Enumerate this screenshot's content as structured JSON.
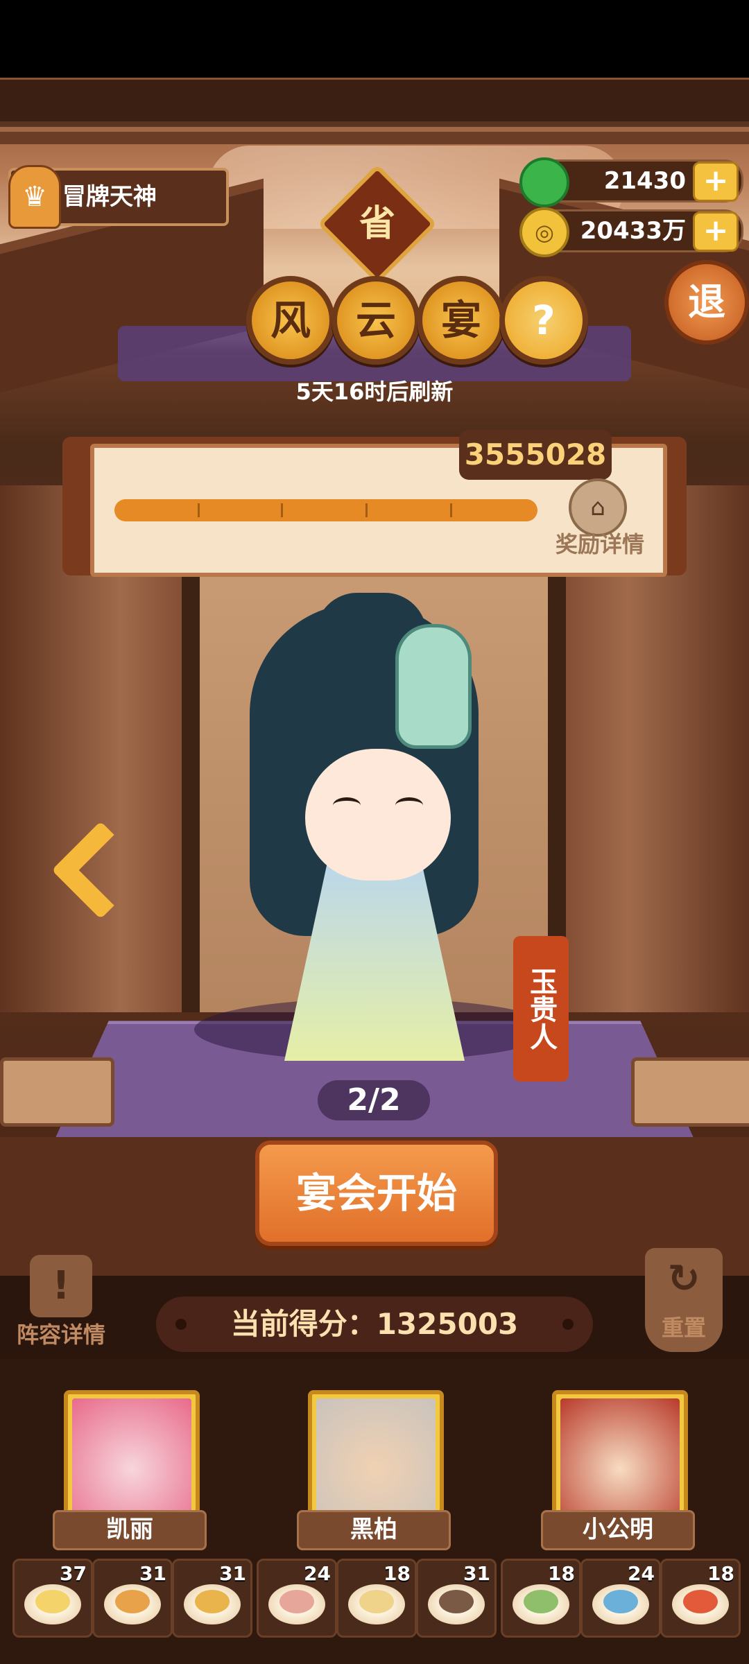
{
  "player": {
    "title": "冒牌天神",
    "title_icon": "chef-icon"
  },
  "currency": [
    {
      "name": "jade",
      "value": "21430",
      "icon": "jade-icon",
      "color": "#3bb54a"
    },
    {
      "name": "coin",
      "value": "20433万",
      "icon": "coin-icon",
      "color": "#f2c23a"
    }
  ],
  "exit": {
    "label": "退"
  },
  "province": {
    "label": "省"
  },
  "event": {
    "title_chars": [
      "风",
      "云",
      "宴"
    ],
    "help": "?",
    "refresh": "5天16时后刷新"
  },
  "progress": {
    "target_score": "3555028",
    "fill": 1.0,
    "reward_label": "奖励详情"
  },
  "character": {
    "name": "玉贵人"
  },
  "pager": {
    "text": "2/2"
  },
  "start_button": {
    "label": "宴会开始"
  },
  "lineup": {
    "label": "阵容详情"
  },
  "reset": {
    "label": "重置"
  },
  "score": {
    "label": "当前得分：1325003"
  },
  "heroes": [
    {
      "name": "凯丽",
      "color": "#e86a8a"
    },
    {
      "name": "黑柏",
      "color": "#c9c3bd"
    },
    {
      "name": "小公明",
      "color": "#b83a2a"
    }
  ],
  "dishes": [
    {
      "count": "37",
      "color": "#f3d36a"
    },
    {
      "count": "31",
      "color": "#e8a24a"
    },
    {
      "count": "31",
      "color": "#e9b44c"
    },
    {
      "count": "24",
      "color": "#e7a69a"
    },
    {
      "count": "18",
      "color": "#f0d38a"
    },
    {
      "count": "31",
      "color": "#7a5a44"
    },
    {
      "count": "18",
      "color": "#8fbf6a"
    },
    {
      "count": "24",
      "color": "#6ab0d8"
    },
    {
      "count": "18",
      "color": "#e35a3a"
    }
  ]
}
